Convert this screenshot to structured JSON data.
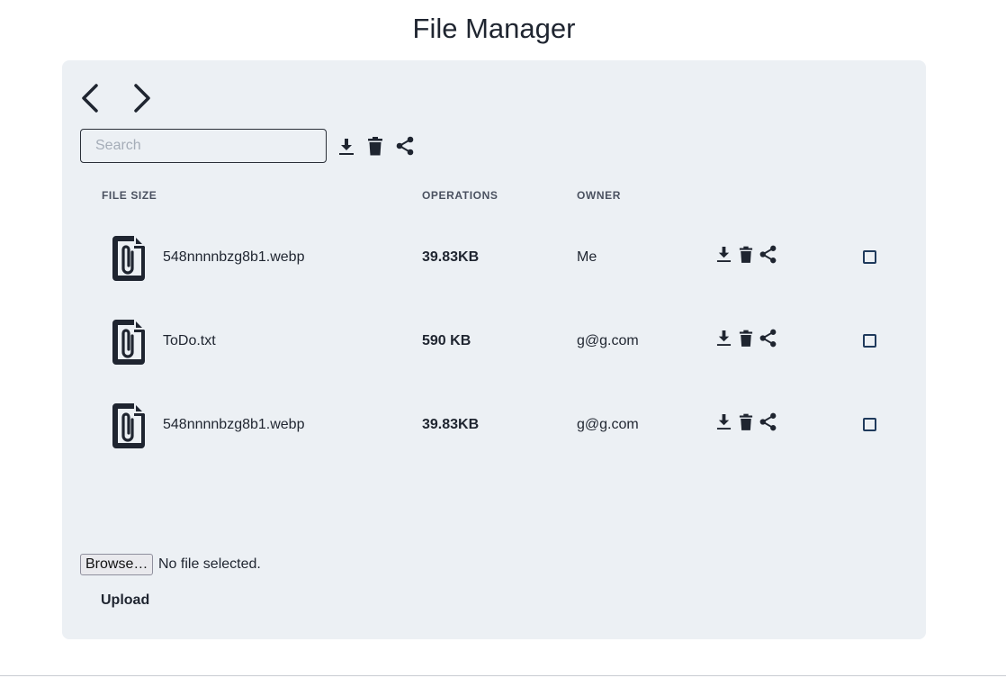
{
  "page": {
    "title": "File Manager"
  },
  "toolbar": {
    "search_placeholder": "Search",
    "icons": [
      "chevron-left-icon",
      "chevron-right-icon",
      "download-icon",
      "trash-icon",
      "share-icon"
    ]
  },
  "table": {
    "headers": {
      "file_size": "FILE SIZE",
      "operations": "OPERATIONS",
      "owner": "OWNER"
    },
    "rows": [
      {
        "name": "548nnnnbzg8b1.webp",
        "size": "39.83KB",
        "owner": "Me",
        "checked": false
      },
      {
        "name": "ToDo.txt",
        "size": "590 KB",
        "owner": "g@g.com",
        "checked": false
      },
      {
        "name": "548nnnnbzg8b1.webp",
        "size": "39.83KB",
        "owner": "g@g.com",
        "checked": false
      }
    ]
  },
  "upload": {
    "browse_label": "Browse…",
    "no_file_text": "No file selected.",
    "upload_label": "Upload"
  },
  "colors": {
    "panel_bg": "#ecf0f4",
    "text": "#1f2530",
    "checkbox_border": "#1f3a5c"
  }
}
